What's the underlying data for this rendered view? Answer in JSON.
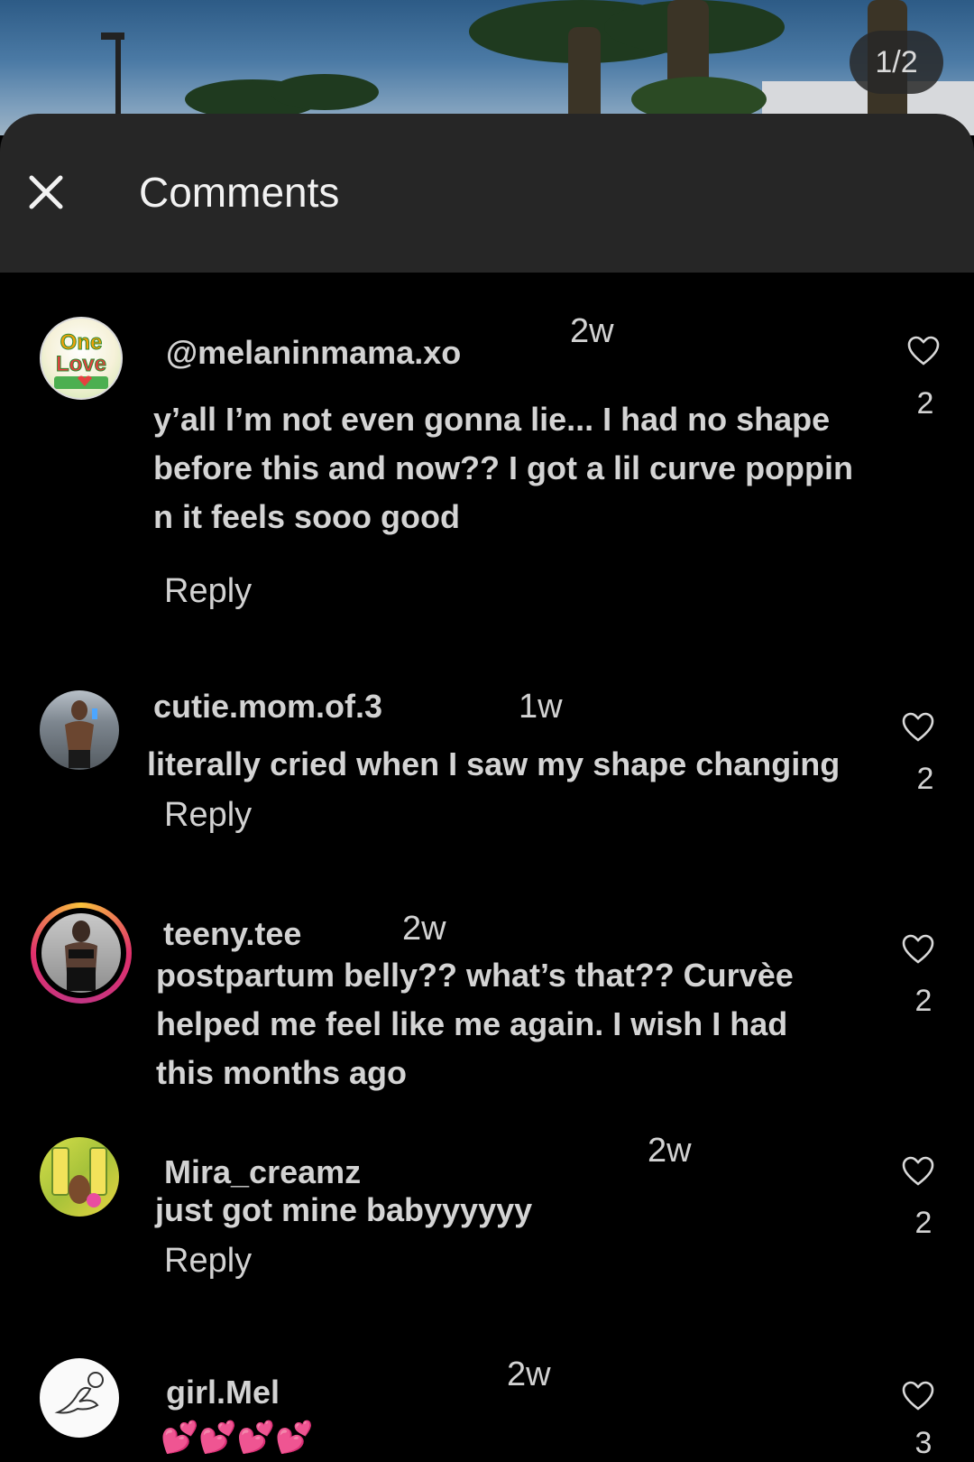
{
  "image_counter": "1/2",
  "header": {
    "title": "Comments",
    "close_icon": "close-icon"
  },
  "colors": {
    "sheet": "#262626",
    "background": "#000000",
    "story_ring": [
      "#f9c23c",
      "#e1306c",
      "#c13584"
    ]
  },
  "comments": [
    {
      "username": "@melaninmama.xo",
      "time": "2w",
      "lines": [
        "y’all I’m not even gonna lie... I had no shape",
        "before this and now?? I got a lil curve poppin",
        "n it feels sooo good"
      ],
      "likes": "2",
      "reply": "Reply",
      "avatar_text": [
        "One",
        "Love"
      ]
    },
    {
      "username": "cutie.mom.of.3",
      "time": "1w",
      "lines": [
        "literally cried when I saw my shape changing"
      ],
      "likes": "2",
      "reply": "Reply"
    },
    {
      "username": "teeny.tee",
      "time": "2w",
      "lines": [
        "postpartum belly?? what’s that?? Curvèe",
        "helped me feel like me again. I wish I had",
        "this months ago"
      ],
      "likes": "2"
    },
    {
      "username": "Mira_creamz",
      "time": "2w",
      "lines": [
        "just got mine babyyyyyy"
      ],
      "likes": "2",
      "reply": "Reply"
    },
    {
      "username": "girl.Mel",
      "time": "2w",
      "lines": [
        "💕💕💕💕"
      ],
      "likes": "3"
    }
  ]
}
